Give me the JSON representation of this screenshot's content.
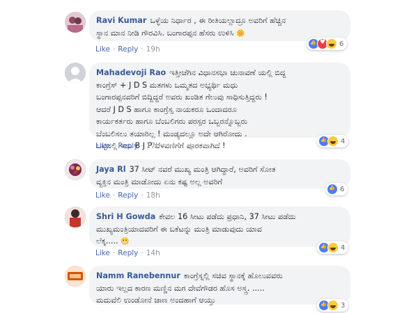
{
  "actions": {
    "like": "Like",
    "reply": "Reply"
  },
  "comments": [
    {
      "author": "Ravi Kumar",
      "lines": [
        "ಒಳ್ಳೆಯ ನಿರ್ಧಾರ , ಈ ರೀತಿಯಲ್ಲಾದ್ರೂ ಅವರಿಗೆ ಹೆಚ್ಚಿನ",
        "ಸ್ಥಾನ ಮಾನ ನೀಡಿ ಗೌರವಿಸಿ. ಬಂಗಾರಪ್ಪನ ಹೆಸರು ಉಳಿಸಿ"
      ],
      "time": "19h",
      "reaction_count": "6",
      "avatar_color": "#c9a0b8"
    },
    {
      "author": "Mahadevoji Rao",
      "lines": [
        "ಇತ್ತೀಚೆಗಿನ ವಿಧಾನಸಭಾ ಚುನಾವಣೆ ಯಲ್ಲಿ ಬಿದ್ದ",
        "ಕಾಂಗ್ರೆಸ್ + J D S ಮತಗಳು ಒಮ್ಮತದ ಅಭ್ಯರ್ಥಿ ಮಧು",
        "ಬಂಗಾರಪ್ಪನವರಿಗೆ ಬಿದ್ದಿದ್ದರೆ ಅವರು ಖಂಡಿತ ಗೆಲುವು ಸಾಧಿಸುತ್ತಿದ್ದರು !",
        "ಆದರೆ J D S ಹಾಗೂ ಕಾಂಗ್ರೆಸ್ಸ ನಾಯಕರೂ ಒಂದಾದರೂ",
        "ಕಾರ್ಯಕರ್ತರು ಹಾಗೂ ಬೆಂಬಲಿಗರು ಪರಸ್ಪರ ಒಬ್ಬರನ್ನೊಬ್ಬರು",
        "ಬೆಂಬಲಿಸಲು ತಯಾರಿಲ್ಲ ! ಮಂಡ್ಯದಲ್ಲೂ ಅದೇ ಆಗಿರೋದು .",
        "ಒಟ್ಟಿನಲ್ಲಿ ಇದು B J P ಬೆಳವಣಿಗೆಗೆ ಪೂರಕವಾಗಿದೆ !"
      ],
      "time": "17h",
      "reaction_count": "4",
      "avatar_color": "#d0d3d8"
    },
    {
      "author": "Jaya Rl",
      "lines": [
        "37 ಸೀಟ್ ನವರೆ ಮುಖ್ಯ ಮಂತ್ರಿ ಆಗಿದ್ದಾರೆ, ಅವರಿಗೆ ಸೋತ",
        "ವ್ಯಕ್ತಿನ ಮಂತ್ರಿ ಮಾಡೋದು ಏನು ಕಷ್ಟ ಅಲ್ಲ ಅವರಿಗೆ"
      ],
      "time": "18h",
      "reaction_count": "6",
      "avatar_color": "#7a5a7a"
    },
    {
      "author": "Shri H Gowda",
      "lines": [
        "ಕೇವಲ 16 ಸೀಟು ಪಡೆದು ಪ್ರಧಾನಿ, 37 ಸೀಟು ಪಡೆದು",
        "ಮುಖ್ಯಮಂತ್ರಿಯಾದವರಿಗೆ ಈ ಬಕೆಟನ್ನು ಮಂತ್ರಿ ಮಾಡುವುದು ಯಾವ",
        "ಲೆಕ್ಕ....."
      ],
      "time": "14h",
      "reaction_count": "4",
      "avatar_color": "#c0392b"
    },
    {
      "author": "Namm Ranebennur",
      "lines": [
        "ಕಾಂಗ್ರೆಸ್ನಲ್ಲಿ ಸಚಿವ ಸ್ಥಾನಕ್ಕೆ ಹೊಲುವವರು",
        "ಯಾರು ಇಲ್ಲದ ಕಾರಣ ಮಣ್ಣಿನ ಮಗ ದೇವೆಗೌಡರ ಹೊಸ ಅಸ್ತ್ರ. .....",
        "ಮದುವೆಲಿ ಉಂಡೋನೆ ಜಾಣ ಅಂದಹಾಗೆ ಆಯ್ತು"
      ],
      "time": "",
      "reaction_count": "3",
      "avatar_color": "#e07a2a"
    }
  ]
}
